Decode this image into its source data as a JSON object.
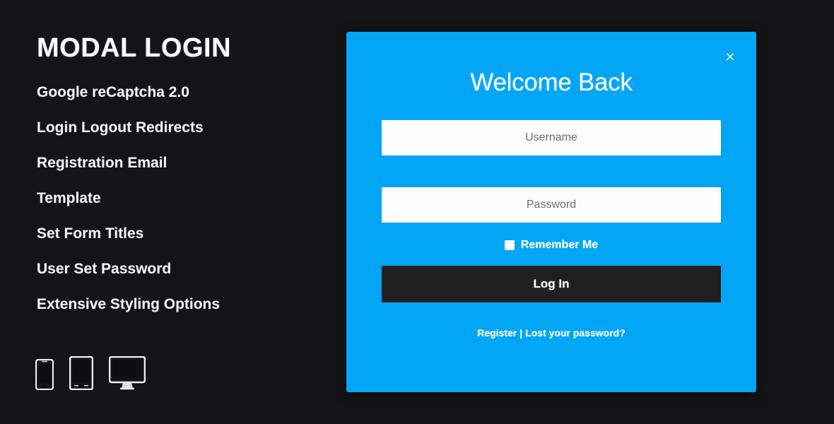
{
  "page": {
    "background_color": "#141416"
  },
  "promo": {
    "title": "MODAL LOGIN",
    "features": [
      {
        "label": "Google reCaptcha 2.0"
      },
      {
        "label": "Login Logout Redirects"
      },
      {
        "label": "Registration Email"
      },
      {
        "label": "Template"
      },
      {
        "label": "Set Form Titles"
      },
      {
        "label": "User Set Password"
      },
      {
        "label": "Extensive Styling Options"
      }
    ],
    "devices": [
      {
        "icon": "mobile-phone-icon",
        "name": "phone"
      },
      {
        "icon": "tablet-icon",
        "name": "tablet"
      },
      {
        "icon": "desktop-monitor-icon",
        "name": "desktop"
      }
    ]
  },
  "modal": {
    "accent_color": "#03a5f5",
    "title": "Welcome Back",
    "close_icon": "close-icon",
    "close_label": "×",
    "username": {
      "placeholder": "Username",
      "value": ""
    },
    "password": {
      "placeholder": "Password",
      "value": ""
    },
    "remember": {
      "label": "Remember Me",
      "checked": false
    },
    "submit_label": "Log In",
    "footer": {
      "register_label": "Register",
      "separator": "|",
      "lost_password_label": "Lost your password?"
    }
  }
}
